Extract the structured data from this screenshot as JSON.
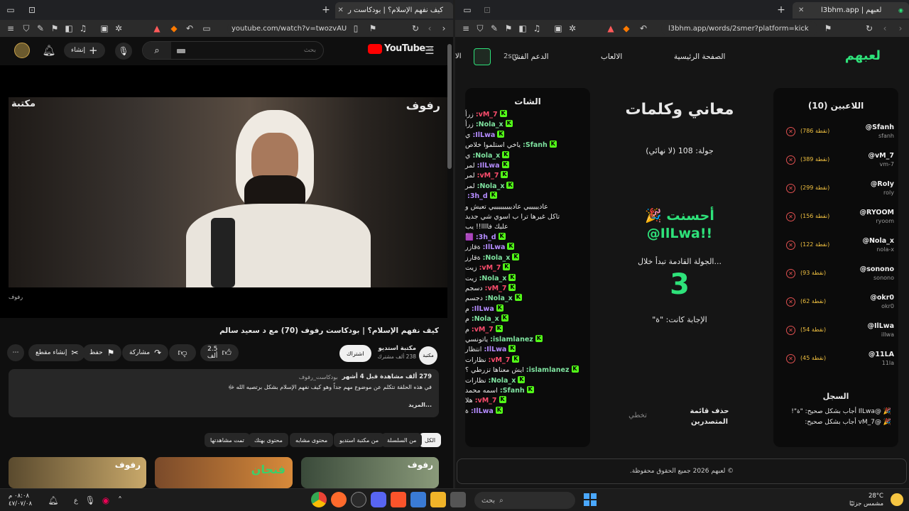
{
  "left_window": {
    "tab_title": "كيف نفهم الإسلام؟ | بودكاست ر",
    "url": "youtube.com/watch?v=twozvAUO6Qg",
    "youtube": {
      "logo": "YouTube",
      "region": "SA",
      "search_placeholder": "بحث",
      "create_label": "إنشاء",
      "video_watermark": "رفوف",
      "channel_watermark": "مكتبة",
      "video_title": "كيف نفهم الإسلام؟ | بودكاست رفوف (70) مع د سعيد سالم",
      "channel_name": "مكتبة استديو",
      "subscribers": "238 ألف مشترك",
      "subscribe_label": "اشتراك",
      "likes": "2.5 ألف",
      "share_label": "مشاركة",
      "save_label": "حفظ",
      "clip_label": "إنشاء مقطع",
      "views_meta": "279 ألف مشاهدة قبل 4 أشهر",
      "hashtag": "بودكاست_رفوف",
      "description": "في هذه الحلقة نتكلم عن موضوع مهم جداً وهو كيف نفهم الإسلام بشكل برتصيه الله ﷻ",
      "more_label": "...المزيد",
      "chips": [
        "الكل",
        "من السلسلة",
        "من مكتبة استديو",
        "محتوى مشابه",
        "محتوى بهتك",
        "تمت مشاهدتها"
      ],
      "thumbnails": [
        "رفوف",
        "فنجان",
        "رفوف"
      ]
    }
  },
  "right_window": {
    "tab_title": "لعبهم | l3bhm.app",
    "url": "l3bhm.app/words/2smer?platform=kick",
    "site": {
      "logo": "لعبهم",
      "nav": [
        "الصفحة الرئيسية",
        "الالعاب",
        "الدعم الفني"
      ],
      "username_fragment": "2sm",
      "nav_overflow": "الا",
      "players_title": "اللاعبين (10)",
      "players": [
        {
          "name": "@Sfanh",
          "handle": "sfanh",
          "points": "(786 نقطة)"
        },
        {
          "name": "@vM_7",
          "handle": "vm-7",
          "points": "(389 نقطة)"
        },
        {
          "name": "@RoIy",
          "handle": "roly",
          "points": "(299 نقطة)"
        },
        {
          "name": "@RYOOM",
          "handle": "ryoom",
          "points": "(156 نقطة)"
        },
        {
          "name": "@Nola_x",
          "handle": "nola-x",
          "points": "(122 نقطة)"
        },
        {
          "name": "@sonono",
          "handle": "sonono",
          "points": "(93 نقطة)"
        },
        {
          "name": "@okr0",
          "handle": "okr0",
          "points": "(62 نقطة)"
        },
        {
          "name": "@IlLwa",
          "handle": "illwa",
          "points": "(54 نقطة)"
        },
        {
          "name": "@11LA",
          "handle": "11la",
          "points": "(45 نقطة)"
        }
      ],
      "game_title": "معاني وكلمات",
      "round": "جولة: 108 (لا نهائي)",
      "congrats": "أحسنت 🎉",
      "winner": "@IlLwa!!",
      "next_round": "الجولة القادمة تبدأ خلال...",
      "countdown": "3",
      "answer": "الإجابة كانت: \"ة\"",
      "delete_leaderboard": "حذف قائمة المتصدرين",
      "skip": "تخطي",
      "chat_title": "الشات",
      "chat": [
        {
          "user": "vM_7:",
          "color": "#ff4d6d",
          "msg": "زرأ"
        },
        {
          "user": "Nola_x:",
          "color": "#7fe3a0",
          "msg": "زرأ"
        },
        {
          "user": "IlLwa:",
          "color": "#b58cff",
          "msg": "ي"
        },
        {
          "user": "Sfanh:",
          "color": "#7fe3a0",
          "msg": "ياخي استلموا خلاص"
        },
        {
          "user": "Nola_x:",
          "color": "#7fe3a0",
          "msg": "ي"
        },
        {
          "user": "IlLwa:",
          "color": "#b58cff",
          "msg": "لمر"
        },
        {
          "user": "vM_7:",
          "color": "#ff4d6d",
          "msg": "لمر"
        },
        {
          "user": "Nola_x:",
          "color": "#7fe3a0",
          "msg": "لمر"
        },
        {
          "user": "3h_d:",
          "color": "#b58cff",
          "msg": ""
        },
        {
          "user": "",
          "color": "#e8e8e8",
          "msg": "عاديييييي عاديييييييييي تعيش و"
        },
        {
          "user": "",
          "color": "#e8e8e8",
          "msg": "تاكل غيرها ترا ب اسوي شي جديد"
        },
        {
          "user": "",
          "color": "#e8e8e8",
          "msg": "عليك فاااا!! يب"
        },
        {
          "user": "3h_d:",
          "color": "#b58cff",
          "msg": "🟪"
        },
        {
          "user": "IlLwa:",
          "color": "#b58cff",
          "msg": "ةقازر"
        },
        {
          "user": "Nola_x:",
          "color": "#7fe3a0",
          "msg": "ةقارز"
        },
        {
          "user": "vM_7:",
          "color": "#ff4d6d",
          "msg": "زيت"
        },
        {
          "user": "Nola_x:",
          "color": "#7fe3a0",
          "msg": "زيت"
        },
        {
          "user": "vM_7:",
          "color": "#ff4d6d",
          "msg": "دسجم"
        },
        {
          "user": "Nola_x:",
          "color": "#7fe3a0",
          "msg": "دجسم"
        },
        {
          "user": "IlLwa:",
          "color": "#b58cff",
          "msg": "م"
        },
        {
          "user": "Nola_x:",
          "color": "#7fe3a0",
          "msg": "م"
        },
        {
          "user": "vM_7:",
          "color": "#ff4d6d",
          "msg": "م"
        },
        {
          "user": "islamlanez:",
          "color": "#7fe3a0",
          "msg": "ياتونسي"
        },
        {
          "user": "IlLwa:",
          "color": "#b58cff",
          "msg": "انتظار"
        },
        {
          "user": "vM_7:",
          "color": "#ff4d6d",
          "msg": "نظارات"
        },
        {
          "user": "islamlanez:",
          "color": "#7fe3a0",
          "msg": "ايش معناها تزرطي ؟"
        },
        {
          "user": "Nola_x:",
          "color": "#7fe3a0",
          "msg": "نظارات"
        },
        {
          "user": "Sfanh:",
          "color": "#7fe3a0",
          "msg": "اسمه محمد"
        },
        {
          "user": "vM_7:",
          "color": "#ff4d6d",
          "msg": "هلا"
        },
        {
          "user": "IlLwa:",
          "color": "#b58cff",
          "msg": "ة"
        }
      ],
      "log_title": "السجل",
      "log": [
        "🎉 @IlLwa أجاب بشكل صحيح: \"ة\"!",
        "🎉 @vM_7 أجاب بشكل صحيح:"
      ],
      "footer": "© لعبهم 2026 جميع الحقوق محفوظة."
    }
  },
  "taskbar": {
    "search_placeholder": "بحث",
    "time": "٠٨:٠٨ م",
    "date": "٤٧/٠٧/٠٨",
    "weather_temp": "28°C",
    "weather_desc": "مشمس جزئيًا",
    "lang": "ع"
  },
  "colors": {
    "kick_green": "#53fc18",
    "accent_green": "#2ee27a",
    "youtube_red": "#ff0000"
  }
}
